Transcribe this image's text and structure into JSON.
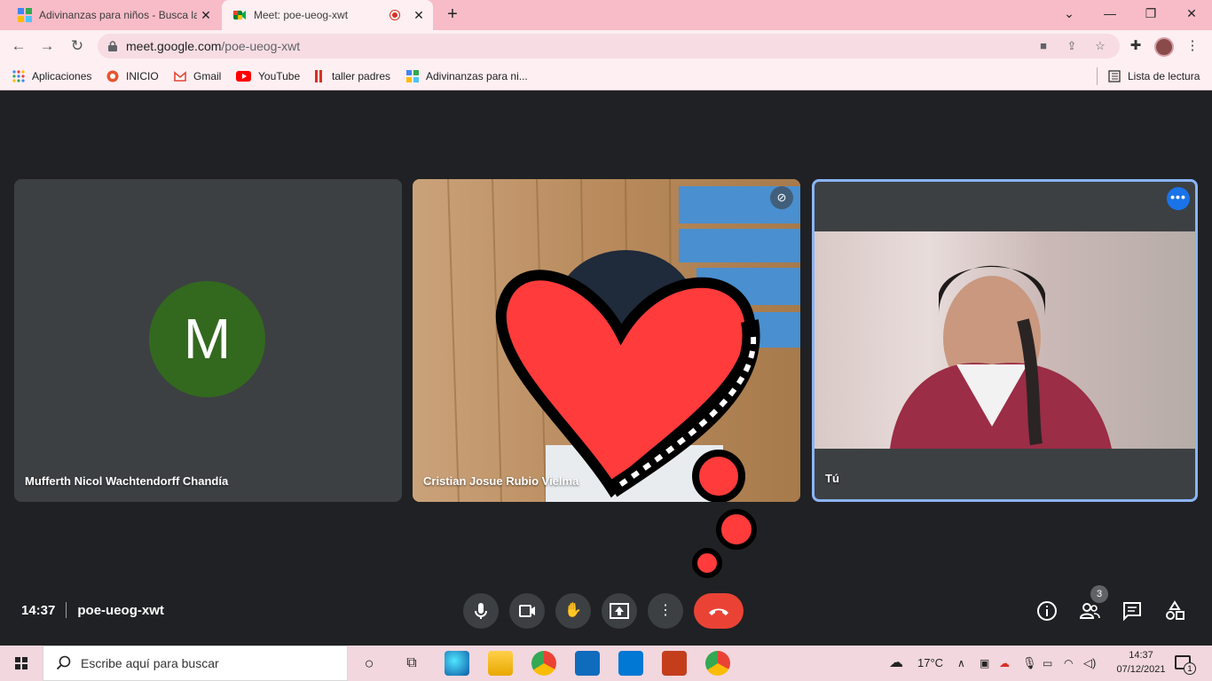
{
  "browser": {
    "tabs": [
      {
        "title": "Adivinanzas para niños - Busca la",
        "icon": "grid-favicon-icon",
        "active": false
      },
      {
        "title": "Meet: poe-ueog-xwt",
        "icon": "google-meet-icon",
        "active": true,
        "recording": true
      }
    ],
    "new_tab": "+",
    "address": {
      "domain": "meet.google.com",
      "path": "/poe-ueog-xwt"
    },
    "bookmarks": [
      {
        "label": "Aplicaciones",
        "icon": "apps-grid-icon"
      },
      {
        "label": "INICIO",
        "icon": "inicio-icon"
      },
      {
        "label": "Gmail",
        "icon": "gmail-icon"
      },
      {
        "label": "YouTube",
        "icon": "youtube-icon"
      },
      {
        "label": "taller padres",
        "icon": "taller-icon"
      },
      {
        "label": "Adivinanzas para ni...",
        "icon": "grid-favicon-icon"
      }
    ],
    "reading_list": "Lista de lectura"
  },
  "meet": {
    "participants": [
      {
        "name": "Mufferth Nicol Wachtendorff Chandía",
        "initial": "M",
        "avatar_color": "#33691e",
        "video": false
      },
      {
        "name": "Cristian Josue Rubio Vielma",
        "video": true,
        "muted": true
      },
      {
        "name": "Tú",
        "video": true,
        "is_self": true
      }
    ],
    "time": "14:37",
    "meeting_code": "poe-ueog-xwt",
    "people_count": "3",
    "hangup_color": "#ea4335"
  },
  "taskbar": {
    "search_placeholder": "Escribe aquí para buscar",
    "weather": "17°C",
    "time": "14:37",
    "date": "07/12/2021",
    "notifications": "1"
  }
}
